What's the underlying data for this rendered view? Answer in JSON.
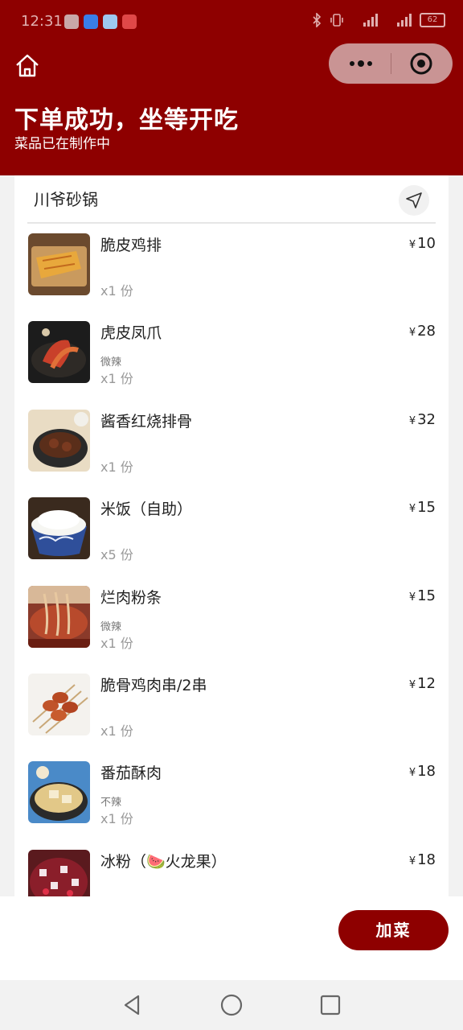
{
  "status_bar": {
    "time": "12:31",
    "battery": "62"
  },
  "header": {
    "title": "下单成功，坐等开吃",
    "subtitle": "菜品已在制作中"
  },
  "shop": {
    "name": "川爷砂锅"
  },
  "currency": "¥",
  "items": [
    {
      "name": "脆皮鸡排",
      "spec": "",
      "qty": "x1 份",
      "price": "10"
    },
    {
      "name": "虎皮凤爪",
      "spec": "微辣",
      "qty": "x1 份",
      "price": "28"
    },
    {
      "name": "酱香红烧排骨",
      "spec": "",
      "qty": "x1 份",
      "price": "32"
    },
    {
      "name": "米饭（自助）",
      "spec": "",
      "qty": "x5 份",
      "price": "15"
    },
    {
      "name": "烂肉粉条",
      "spec": "微辣",
      "qty": "x1 份",
      "price": "15"
    },
    {
      "name": "脆骨鸡肉串/2串",
      "spec": "",
      "qty": "x1 份",
      "price": "12"
    },
    {
      "name": "番茄酥肉",
      "spec": "不辣",
      "qty": "x1 份",
      "price": "18"
    },
    {
      "name": "冰粉（🍉火龙果）",
      "spec": "",
      "qty": "",
      "price": "18"
    }
  ],
  "actions": {
    "add_dish": "加菜"
  },
  "colors": {
    "brand": "#8e0000",
    "capsule": "#c99494"
  }
}
